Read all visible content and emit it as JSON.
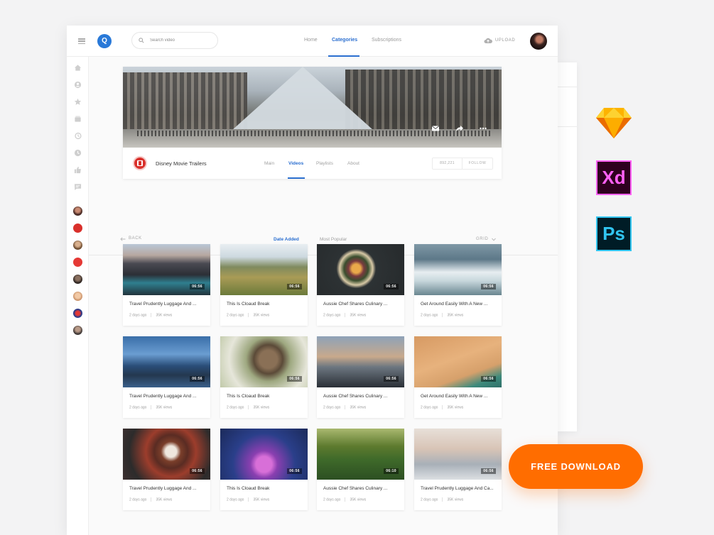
{
  "header": {
    "logo_letter": "Q",
    "search_placeholder": "Search video",
    "nav": [
      "Home",
      "Categories",
      "Subscriptions"
    ],
    "upload_label": "UPLOAD"
  },
  "channel": {
    "name": "Disney Movie Trailers",
    "tabs": [
      "Main",
      "Videos",
      "Playlists",
      "About"
    ],
    "subscribers": "892,221",
    "follow_label": "FOLLOW"
  },
  "filters": {
    "back_label": "BACK",
    "tabs": [
      "Date Added",
      "Most Popular"
    ],
    "view_label": "GRID"
  },
  "videos": [
    {
      "title": "Travel Prudently Luggage And ...",
      "age": "2 days ago",
      "views": "35K views",
      "duration": "06:56"
    },
    {
      "title": "This Is Cloaud Break",
      "age": "2 days ago",
      "views": "35K views",
      "duration": "06:56"
    },
    {
      "title": "Aussie Chef Shares Culinary ...",
      "age": "2 days ago",
      "views": "35K views",
      "duration": "06:56"
    },
    {
      "title": "Get Around Easily With A New ...",
      "age": "2 days ago",
      "views": "35K views",
      "duration": "06:56"
    },
    {
      "title": "Travel Prudently Luggage And ...",
      "age": "2 days ago",
      "views": "35K views",
      "duration": "06:56"
    },
    {
      "title": "This Is Cloaud Break",
      "age": "2 days ago",
      "views": "35K views",
      "duration": "06:56"
    },
    {
      "title": "Aussie Chef Shares Culinary ...",
      "age": "2 days ago",
      "views": "35K views",
      "duration": "06:56"
    },
    {
      "title": "Get Around Easily With A New ...",
      "age": "2 days ago",
      "views": "35K views",
      "duration": "06:56"
    },
    {
      "title": "Travel Prudently Luggage And ...",
      "age": "2 days ago",
      "views": "35K views",
      "duration": "06:56"
    },
    {
      "title": "This Is Cloaud Break",
      "age": "2 days ago",
      "views": "35K views",
      "duration": "06:56"
    },
    {
      "title": "Aussie Chef Shares Culinary ...",
      "age": "2 days ago",
      "views": "35K views",
      "duration": "06:10"
    },
    {
      "title": "Travel Prudently Luggage And Ca...",
      "age": "2 days ago",
      "views": "35K views",
      "duration": "06:56"
    }
  ],
  "tools": {
    "xd": "Xd",
    "ps": "Ps"
  },
  "download_label": "FREE DOWNLOAD",
  "colors": {
    "accent": "#2b6fd0",
    "download": "#ff6d00",
    "channel_red": "#d9302b"
  }
}
